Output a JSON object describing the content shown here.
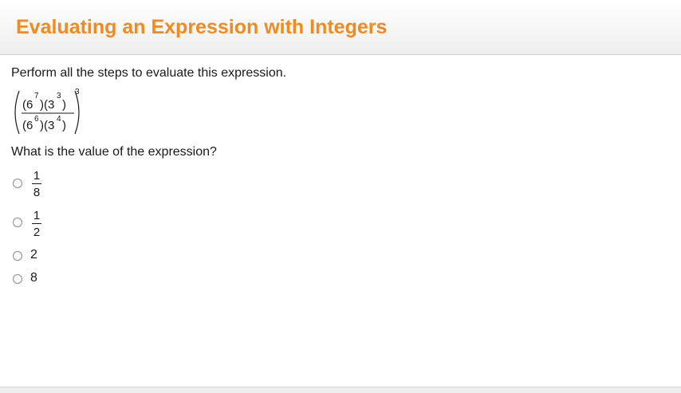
{
  "header": {
    "title": "Evaluating an Expression with Integers",
    "title_color": "#f28a1f"
  },
  "problem": {
    "prompt": "Perform all the steps to evaluate this expression.",
    "expression": {
      "numerator": {
        "base1": "6",
        "exp1": "7",
        "base2": "3",
        "exp2": "3"
      },
      "denominator": {
        "base1": "6",
        "exp1": "6",
        "base2": "3",
        "exp2": "4"
      },
      "outer_exponent": "3"
    },
    "question": "What is the value of the expression?"
  },
  "options": [
    {
      "type": "fraction",
      "numerator": "1",
      "denominator": "8"
    },
    {
      "type": "fraction",
      "numerator": "1",
      "denominator": "2"
    },
    {
      "type": "integer",
      "value": "2"
    },
    {
      "type": "integer",
      "value": "8"
    }
  ]
}
